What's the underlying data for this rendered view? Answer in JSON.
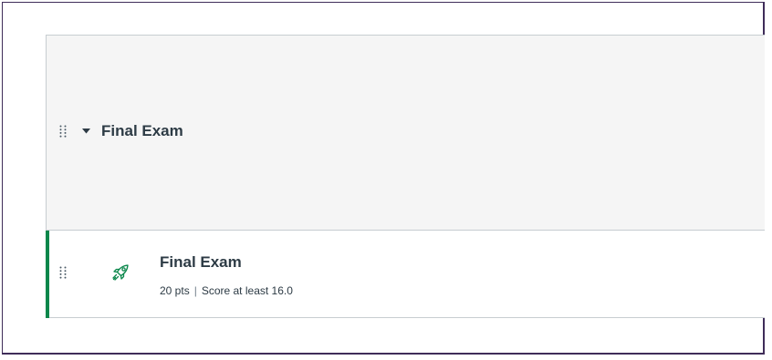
{
  "module": {
    "title": "Final Exam",
    "drag_icon": "drag-handle-icon",
    "toggle_icon": "caret-down-icon"
  },
  "items": [
    {
      "title": "Final Exam",
      "points": "20 pts",
      "separator": "|",
      "requirement": "Score at least 16.0",
      "icon": "quiz-rocket-icon",
      "drag_icon": "drag-handle-icon",
      "status_color": "#0b874b"
    }
  ],
  "colors": {
    "header_bg": "#f5f5f5",
    "text": "#2d3b45",
    "border": "#c7cdd1",
    "published": "#0b874b",
    "frame": "#3f2d59"
  }
}
